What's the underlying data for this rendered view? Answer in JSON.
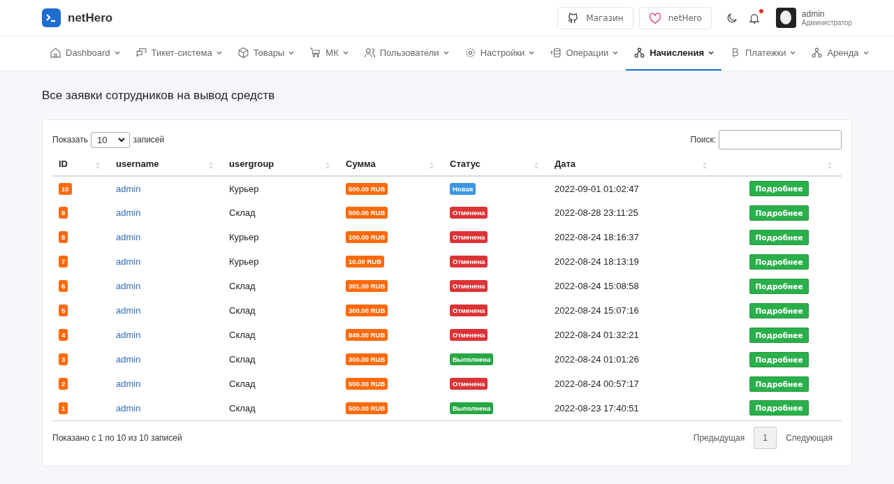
{
  "brand": "netHero",
  "header_buttons": [
    "Магазин",
    "netHero"
  ],
  "notifications": {
    "unread": true
  },
  "user": {
    "name": "admin",
    "role": "Администратор"
  },
  "nav": [
    {
      "label": "Dashboard",
      "selected": false
    },
    {
      "label": "Тикет-система",
      "selected": false
    },
    {
      "label": "Товары",
      "selected": false
    },
    {
      "label": "МК",
      "selected": false
    },
    {
      "label": "Пользователи",
      "selected": false
    },
    {
      "label": "Настройки",
      "selected": false
    },
    {
      "label": "Операции",
      "selected": false
    },
    {
      "label": "Начисления",
      "selected": true
    },
    {
      "label": "Платежки",
      "selected": false
    },
    {
      "label": "Аренда",
      "selected": false
    }
  ],
  "page_title": "Все заявки сотрудников на вывод средств",
  "length_control": {
    "before": "Показать",
    "value": "10",
    "after": "записей"
  },
  "search": {
    "label": "Поиск:"
  },
  "table": {
    "columns": [
      "ID",
      "username",
      "usergroup",
      "Сумма",
      "Статус",
      "Дата"
    ],
    "rows": [
      {
        "id": "10",
        "username": "admin",
        "usergroup": "Курьер",
        "amount": "500.00 RUB",
        "status": {
          "label": "Новая",
          "kind": "new"
        },
        "date": "2022-09-01 01:02:47",
        "action": "Подробнее"
      },
      {
        "id": "9",
        "username": "admin",
        "usergroup": "Склад",
        "amount": "500.00 RUB",
        "status": {
          "label": "Отменена",
          "kind": "cancelled"
        },
        "date": "2022-08-28 23:11:25",
        "action": "Подробнее"
      },
      {
        "id": "8",
        "username": "admin",
        "usergroup": "Курьер",
        "amount": "100.00 RUB",
        "status": {
          "label": "Отменена",
          "kind": "cancelled"
        },
        "date": "2022-08-24 18:16:37",
        "action": "Подробнее"
      },
      {
        "id": "7",
        "username": "admin",
        "usergroup": "Курьер",
        "amount": "10.00 RUB",
        "status": {
          "label": "Отменена",
          "kind": "cancelled"
        },
        "date": "2022-08-24 18:13:19",
        "action": "Подробнее"
      },
      {
        "id": "6",
        "username": "admin",
        "usergroup": "Склад",
        "amount": "301.00 RUB",
        "status": {
          "label": "Отменена",
          "kind": "cancelled"
        },
        "date": "2022-08-24 15:08:58",
        "action": "Подробнее"
      },
      {
        "id": "5",
        "username": "admin",
        "usergroup": "Склад",
        "amount": "300.00 RUB",
        "status": {
          "label": "Отменена",
          "kind": "cancelled"
        },
        "date": "2022-08-24 15:07:16",
        "action": "Подробнее"
      },
      {
        "id": "4",
        "username": "admin",
        "usergroup": "Склад",
        "amount": "849.00 RUB",
        "status": {
          "label": "Отменена",
          "kind": "cancelled"
        },
        "date": "2022-08-24 01:32:21",
        "action": "Подробнее"
      },
      {
        "id": "3",
        "username": "admin",
        "usergroup": "Склад",
        "amount": "300.00 RUB",
        "status": {
          "label": "Выполнена",
          "kind": "done"
        },
        "date": "2022-08-24 01:01:26",
        "action": "Подробнее"
      },
      {
        "id": "2",
        "username": "admin",
        "usergroup": "Склад",
        "amount": "500.00 RUB",
        "status": {
          "label": "Отменена",
          "kind": "cancelled"
        },
        "date": "2022-08-24 00:57:17",
        "action": "Подробнее"
      },
      {
        "id": "1",
        "username": "admin",
        "usergroup": "Склад",
        "amount": "500.00 RUB",
        "status": {
          "label": "Выполнена",
          "kind": "done"
        },
        "date": "2022-08-23 17:40:51",
        "action": "Подробнее"
      }
    ]
  },
  "info": "Показано с 1 по 10 из 10 записей",
  "pagination": {
    "previous": "Предыдущая",
    "pages": [
      {
        "label": "1",
        "selected": true
      }
    ],
    "next": "Следующая"
  }
}
